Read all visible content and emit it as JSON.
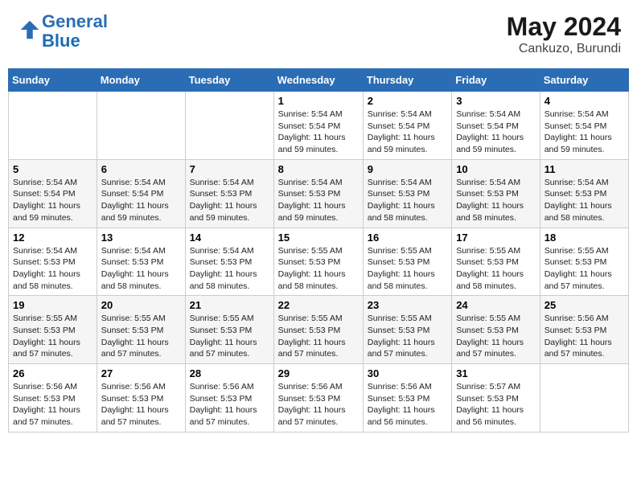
{
  "header": {
    "logo_line1": "General",
    "logo_line2": "Blue",
    "month_year": "May 2024",
    "location": "Cankuzo, Burundi"
  },
  "weekdays": [
    "Sunday",
    "Monday",
    "Tuesday",
    "Wednesday",
    "Thursday",
    "Friday",
    "Saturday"
  ],
  "weeks": [
    [
      null,
      null,
      null,
      {
        "day": 1,
        "sunrise": "5:54 AM",
        "sunset": "5:54 PM",
        "daylight": "11 hours and 59 minutes."
      },
      {
        "day": 2,
        "sunrise": "5:54 AM",
        "sunset": "5:54 PM",
        "daylight": "11 hours and 59 minutes."
      },
      {
        "day": 3,
        "sunrise": "5:54 AM",
        "sunset": "5:54 PM",
        "daylight": "11 hours and 59 minutes."
      },
      {
        "day": 4,
        "sunrise": "5:54 AM",
        "sunset": "5:54 PM",
        "daylight": "11 hours and 59 minutes."
      }
    ],
    [
      {
        "day": 5,
        "sunrise": "5:54 AM",
        "sunset": "5:54 PM",
        "daylight": "11 hours and 59 minutes."
      },
      {
        "day": 6,
        "sunrise": "5:54 AM",
        "sunset": "5:54 PM",
        "daylight": "11 hours and 59 minutes."
      },
      {
        "day": 7,
        "sunrise": "5:54 AM",
        "sunset": "5:53 PM",
        "daylight": "11 hours and 59 minutes."
      },
      {
        "day": 8,
        "sunrise": "5:54 AM",
        "sunset": "5:53 PM",
        "daylight": "11 hours and 59 minutes."
      },
      {
        "day": 9,
        "sunrise": "5:54 AM",
        "sunset": "5:53 PM",
        "daylight": "11 hours and 58 minutes."
      },
      {
        "day": 10,
        "sunrise": "5:54 AM",
        "sunset": "5:53 PM",
        "daylight": "11 hours and 58 minutes."
      },
      {
        "day": 11,
        "sunrise": "5:54 AM",
        "sunset": "5:53 PM",
        "daylight": "11 hours and 58 minutes."
      }
    ],
    [
      {
        "day": 12,
        "sunrise": "5:54 AM",
        "sunset": "5:53 PM",
        "daylight": "11 hours and 58 minutes."
      },
      {
        "day": 13,
        "sunrise": "5:54 AM",
        "sunset": "5:53 PM",
        "daylight": "11 hours and 58 minutes."
      },
      {
        "day": 14,
        "sunrise": "5:54 AM",
        "sunset": "5:53 PM",
        "daylight": "11 hours and 58 minutes."
      },
      {
        "day": 15,
        "sunrise": "5:55 AM",
        "sunset": "5:53 PM",
        "daylight": "11 hours and 58 minutes."
      },
      {
        "day": 16,
        "sunrise": "5:55 AM",
        "sunset": "5:53 PM",
        "daylight": "11 hours and 58 minutes."
      },
      {
        "day": 17,
        "sunrise": "5:55 AM",
        "sunset": "5:53 PM",
        "daylight": "11 hours and 58 minutes."
      },
      {
        "day": 18,
        "sunrise": "5:55 AM",
        "sunset": "5:53 PM",
        "daylight": "11 hours and 57 minutes."
      }
    ],
    [
      {
        "day": 19,
        "sunrise": "5:55 AM",
        "sunset": "5:53 PM",
        "daylight": "11 hours and 57 minutes."
      },
      {
        "day": 20,
        "sunrise": "5:55 AM",
        "sunset": "5:53 PM",
        "daylight": "11 hours and 57 minutes."
      },
      {
        "day": 21,
        "sunrise": "5:55 AM",
        "sunset": "5:53 PM",
        "daylight": "11 hours and 57 minutes."
      },
      {
        "day": 22,
        "sunrise": "5:55 AM",
        "sunset": "5:53 PM",
        "daylight": "11 hours and 57 minutes."
      },
      {
        "day": 23,
        "sunrise": "5:55 AM",
        "sunset": "5:53 PM",
        "daylight": "11 hours and 57 minutes."
      },
      {
        "day": 24,
        "sunrise": "5:55 AM",
        "sunset": "5:53 PM",
        "daylight": "11 hours and 57 minutes."
      },
      {
        "day": 25,
        "sunrise": "5:56 AM",
        "sunset": "5:53 PM",
        "daylight": "11 hours and 57 minutes."
      }
    ],
    [
      {
        "day": 26,
        "sunrise": "5:56 AM",
        "sunset": "5:53 PM",
        "daylight": "11 hours and 57 minutes."
      },
      {
        "day": 27,
        "sunrise": "5:56 AM",
        "sunset": "5:53 PM",
        "daylight": "11 hours and 57 minutes."
      },
      {
        "day": 28,
        "sunrise": "5:56 AM",
        "sunset": "5:53 PM",
        "daylight": "11 hours and 57 minutes."
      },
      {
        "day": 29,
        "sunrise": "5:56 AM",
        "sunset": "5:53 PM",
        "daylight": "11 hours and 57 minutes."
      },
      {
        "day": 30,
        "sunrise": "5:56 AM",
        "sunset": "5:53 PM",
        "daylight": "11 hours and 56 minutes."
      },
      {
        "day": 31,
        "sunrise": "5:57 AM",
        "sunset": "5:53 PM",
        "daylight": "11 hours and 56 minutes."
      },
      null
    ]
  ]
}
